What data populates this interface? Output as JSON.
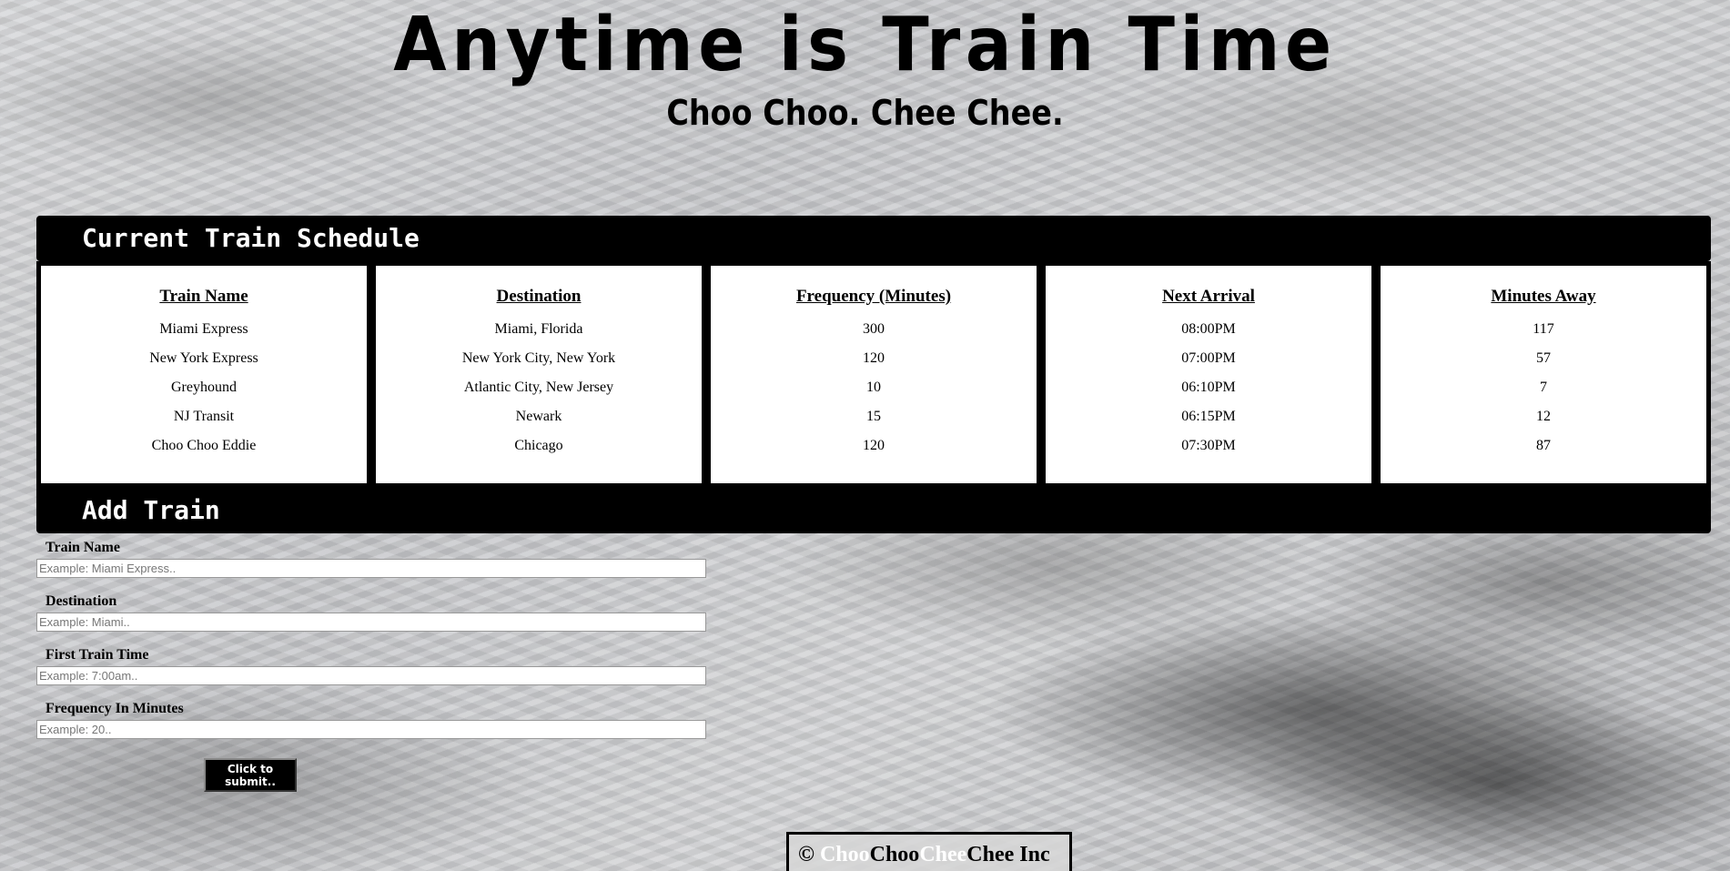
{
  "header": {
    "title": "Anytime is Train Time",
    "subtitle": "Choo Choo. Chee Chee."
  },
  "schedule": {
    "heading": "Current Train Schedule",
    "columns": [
      {
        "header": "Train Name",
        "cells": [
          "Miami Express",
          "New York Express",
          "Greyhound",
          "NJ Transit",
          "Choo Choo Eddie"
        ]
      },
      {
        "header": "Destination",
        "cells": [
          "Miami, Florida",
          "New York City, New York",
          "Atlantic City, New Jersey",
          "Newark",
          "Chicago"
        ]
      },
      {
        "header": "Frequency (Minutes)",
        "cells": [
          "300",
          "120",
          "10",
          "15",
          "120"
        ]
      },
      {
        "header": "Next Arrival",
        "cells": [
          "08:00PM",
          "07:00PM",
          "06:10PM",
          "06:15PM",
          "07:30PM"
        ]
      },
      {
        "header": "Minutes Away",
        "cells": [
          "117",
          "57",
          "7",
          "12",
          "87"
        ]
      }
    ]
  },
  "add_train": {
    "heading": "Add Train",
    "fields": [
      {
        "label": "Train Name",
        "placeholder": "Example: Miami Express..",
        "value": ""
      },
      {
        "label": "Destination",
        "placeholder": "Example: Miami..",
        "value": ""
      },
      {
        "label": "First Train Time",
        "placeholder": "Example: 7:00am..",
        "value": ""
      },
      {
        "label": "Frequency In Minutes",
        "placeholder": "Example: 20..",
        "value": ""
      }
    ],
    "submit_label": "Click to submit.."
  },
  "footer": {
    "copyright_symbol": "©",
    "parts": [
      "Choo",
      "Choo",
      "Chee",
      "Chee",
      "Inc"
    ]
  },
  "colors": {
    "panel_background": "#000000",
    "panel_text": "#ffffff",
    "cell_background": "#ffffff"
  }
}
